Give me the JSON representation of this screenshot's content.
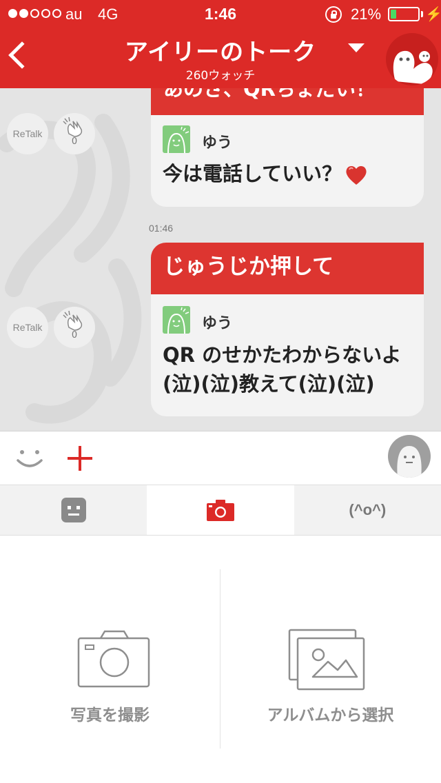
{
  "status_bar": {
    "carrier": "au",
    "network": "4G",
    "time": "1:46",
    "battery_percent": "21%",
    "battery_level": 0.21,
    "signal_bars_filled": 2,
    "signal_bars_total": 5
  },
  "nav": {
    "title": "アイリーのトーク",
    "subtitle": "260ウォッチ"
  },
  "messages": [
    {
      "header": "あのさ、QRちょだい！",
      "sender": "ゆう",
      "text": "今は電話していい？",
      "retalk_label": "ReTalk",
      "clap_count": "0"
    },
    {
      "timestamp": "01:46",
      "header": "じゅうじか押して",
      "sender": "ゆう",
      "text": "QR のせかたわからないよ(泣)(泣)教えて(泣)(泣)",
      "retalk_label": "ReTalk",
      "clap_count": "0"
    }
  ],
  "tabs": {
    "kaomoji_label": "(^o^)"
  },
  "photo_panel": {
    "take_photo_label": "写真を撮影",
    "album_label": "アルバムから選択"
  },
  "colors": {
    "brand_red": "#dc2a27",
    "bubble_header_red": "#dd3530",
    "battery_green": "#4cd964"
  }
}
